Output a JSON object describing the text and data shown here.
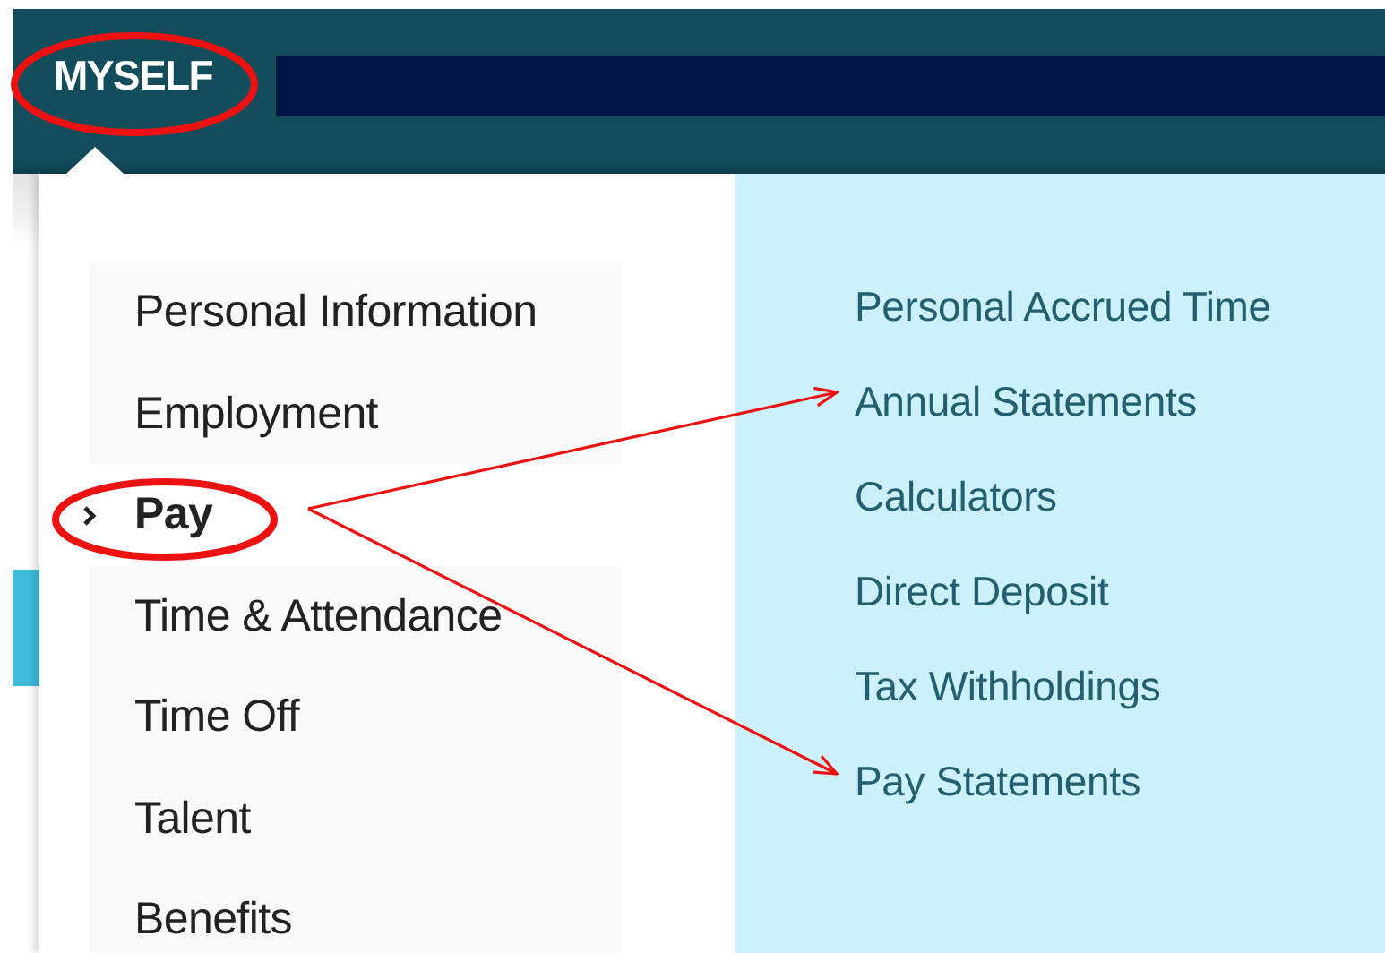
{
  "nav": {
    "label": "MYSELF",
    "selected": true
  },
  "menu": {
    "items": [
      {
        "label": "Personal Information",
        "selected": false
      },
      {
        "label": "Employment",
        "selected": false
      },
      {
        "label": "Pay",
        "selected": true
      },
      {
        "label": "Time & Attendance",
        "selected": false
      },
      {
        "label": "Time Off",
        "selected": false
      },
      {
        "label": "Talent",
        "selected": false
      },
      {
        "label": "Benefits",
        "selected": false
      }
    ]
  },
  "submenu": {
    "items": [
      "Personal Accrued Time",
      "Annual Statements",
      "Calculators",
      "Direct Deposit",
      "Tax Withholdings",
      "Pay Statements"
    ]
  }
}
